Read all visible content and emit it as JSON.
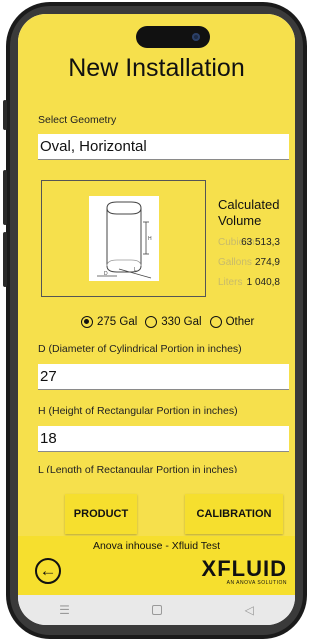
{
  "header": {
    "title": "New Installation"
  },
  "geometry": {
    "label": "Select Geometry",
    "value": "Oval, Horizontal"
  },
  "calculated": {
    "title": "Calculated Volume",
    "rows": [
      {
        "unit": "Cubic In",
        "value": "63 513,3"
      },
      {
        "unit": "Gallons",
        "value": "274,9"
      },
      {
        "unit": "Liters",
        "value": "1 040,8"
      }
    ]
  },
  "diagram": {
    "h": "H",
    "d": "D",
    "l": "L"
  },
  "radio": {
    "options": [
      "275 Gal",
      "330 Gal",
      "Other"
    ],
    "selected": "275 Gal"
  },
  "fields": {
    "d_label": "D (Diameter of Cylindrical Portion in inches)",
    "d_value": "27",
    "h_label": "H (Height of Rectangular Portion in inches)",
    "h_value": "18",
    "l_label": "L (Length of Rectangular Portion in inches)"
  },
  "buttons": {
    "product": "PRODUCT",
    "calibration": "CALIBRATION"
  },
  "footer": {
    "company": "Anova inhouse - Xfluid Test",
    "logo_main": "XFLUID",
    "logo_sub": "AN ANOVA SOLUTION"
  },
  "icons": {
    "back": "arrow-left-circle-icon",
    "nav": [
      "menu-icon",
      "home-icon",
      "back-triangle-icon"
    ]
  },
  "colors": {
    "accent": "#f6df2e",
    "background": "#f6e04c"
  }
}
